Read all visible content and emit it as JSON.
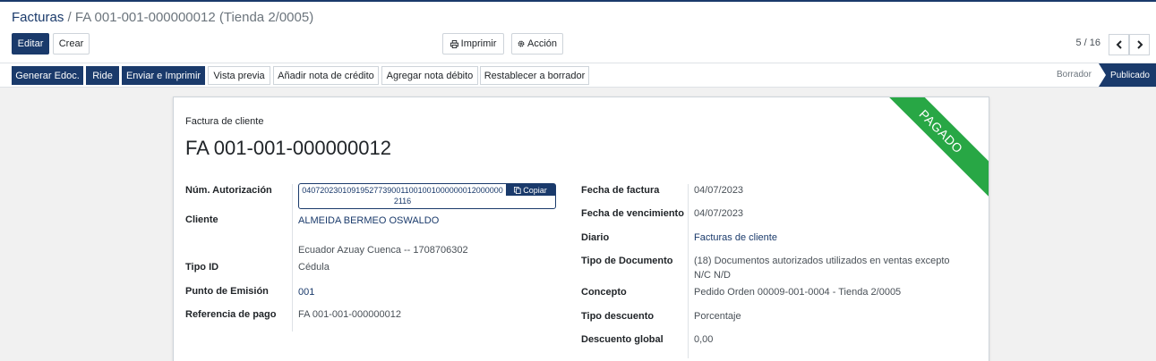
{
  "breadcrumb": {
    "root": "Facturas",
    "separator": "/",
    "current": "FA 001-001-000000012 (Tienda 2/0005)"
  },
  "toolbar": {
    "edit": "Editar",
    "create": "Crear",
    "print": "Imprimir",
    "action": "Acción"
  },
  "pager": {
    "value": "5 / 16"
  },
  "status_buttons": [
    "Generar Edoc.",
    "Ride",
    "Enviar e Imprimir",
    "Vista previa",
    "Añadir nota de crédito",
    "Agregar nota débito",
    "Restablecer a borrador"
  ],
  "states": {
    "draft": "Borrador",
    "published": "Publicado"
  },
  "ribbon": "PAGADO",
  "document": {
    "type": "Factura de cliente",
    "name": "FA 001-001-000000012"
  },
  "left_fields": {
    "auth_label": "Núm. Autorización",
    "auth_value": "0407202301091952773900110010010000000120000002116",
    "copy": "Copiar",
    "client_label": "Cliente",
    "client_value": "ALMEIDA BERMEO OSWALDO",
    "client_address": "Ecuador Azuay Cuenca -- 1708706302",
    "id_type_label": "Tipo ID",
    "id_type_value": "Cédula",
    "emission_label": "Punto de Emisión",
    "emission_value": "001",
    "payref_label": "Referencia de pago",
    "payref_value": "FA 001-001-000000012"
  },
  "right_fields": {
    "invoice_date_label": "Fecha de factura",
    "invoice_date_value": "04/07/2023",
    "due_date_label": "Fecha de vencimiento",
    "due_date_value": "04/07/2023",
    "journal_label": "Diario",
    "journal_value": "Facturas de cliente",
    "doc_type_label": "Tipo de Documento",
    "doc_type_value_1": "(18) Documentos autorizados utilizados en ventas excepto",
    "doc_type_value_2": "N/C N/D",
    "concept_label": "Concepto",
    "concept_value": "Pedido Orden 00009-001-0004 - Tienda 2/0005",
    "discount_type_label": "Tipo descuento",
    "discount_type_value": "Porcentaje",
    "global_discount_label": "Descuento global",
    "global_discount_value": "0,00"
  },
  "colors": {
    "primary": "#1a3a6b",
    "paid_ribbon": "#28a745"
  }
}
